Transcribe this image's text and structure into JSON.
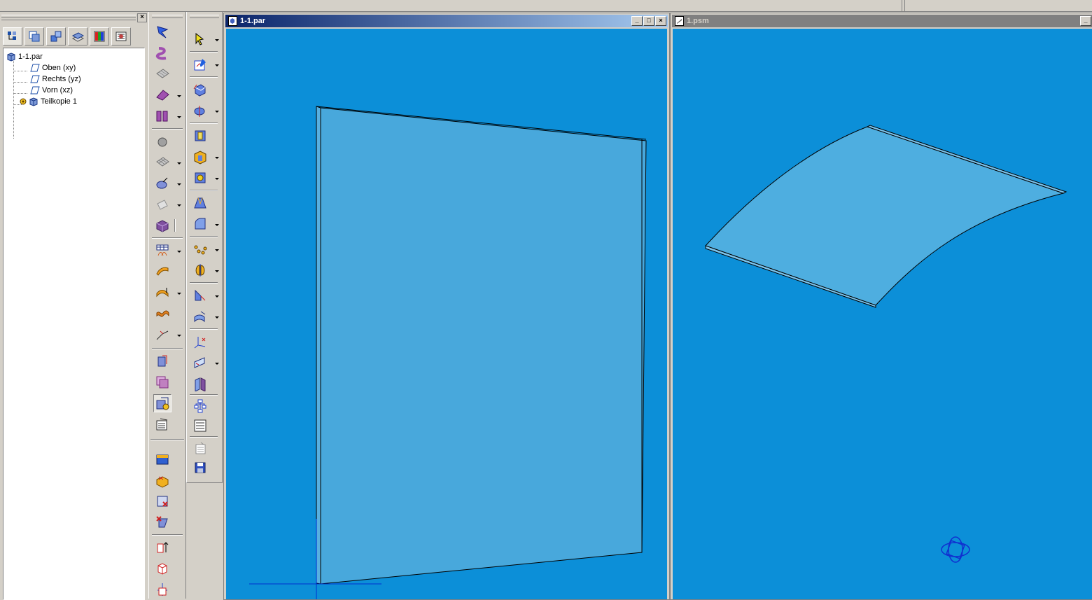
{
  "app": {
    "accent": "#0c8fd8",
    "title_active": "#0a246a",
    "title_inactive": "#808080"
  },
  "pathfinder": {
    "close_label": "×",
    "tabs": [
      {
        "icon": "feature-tree-icon"
      },
      {
        "icon": "layers-icon"
      },
      {
        "icon": "assembly-icon"
      },
      {
        "icon": "stack-icon"
      },
      {
        "icon": "color-grid-icon"
      },
      {
        "icon": "library-icon"
      }
    ],
    "tree": {
      "root": "1-1.par",
      "items": [
        {
          "label": "Oben (xy)",
          "icon": "plane-icon"
        },
        {
          "label": "Rechts (yz)",
          "icon": "plane-icon"
        },
        {
          "label": "Vorn (xz)",
          "icon": "plane-icon"
        },
        {
          "label": "Teilkopie 1",
          "icon": "part-copy-icon"
        }
      ]
    }
  },
  "toolbar_features": {
    "buttons": [
      "flag-icon",
      "sweep-icon",
      "surface-icon",
      "extrude-surface-icon",
      "ruled-surface-icon",
      "sphere-icon",
      "mesh-icon",
      "revolve-icon",
      "shell-icon",
      "box-icon",
      "table-icon",
      "loft-icon",
      "offset-icon",
      "bend-icon",
      "curve-icon",
      "copy-icon",
      "stitch-icon",
      "part-copy-icon",
      "properties-icon",
      "feature-library-icon",
      "box-delete-icon",
      "edit-icon",
      "delete-icon",
      "arrow-up-icon",
      "cube-icon",
      "axis-icon"
    ]
  },
  "toolbar_select": {
    "buttons": [
      "select-arrow-icon",
      "sketch-icon",
      "protrusion-icon",
      "revolve-cut-icon",
      "hole-icon",
      "rib-icon",
      "web-icon",
      "draft-icon",
      "round-icon",
      "pattern-icon",
      "mirror-icon",
      "thin-wall-icon",
      "thicken-icon",
      "coordinate-system-icon",
      "reference-plane-icon",
      "datum-icon",
      "feature-tree-icon",
      "variable-table-icon",
      "copy-properties-icon",
      "save-icon"
    ]
  },
  "windows": [
    {
      "title": "1-1.par",
      "active": true
    },
    {
      "title": "1.psm",
      "active": false
    }
  ],
  "controls": {
    "minimize": "_",
    "maximize": "□",
    "close": "×"
  }
}
